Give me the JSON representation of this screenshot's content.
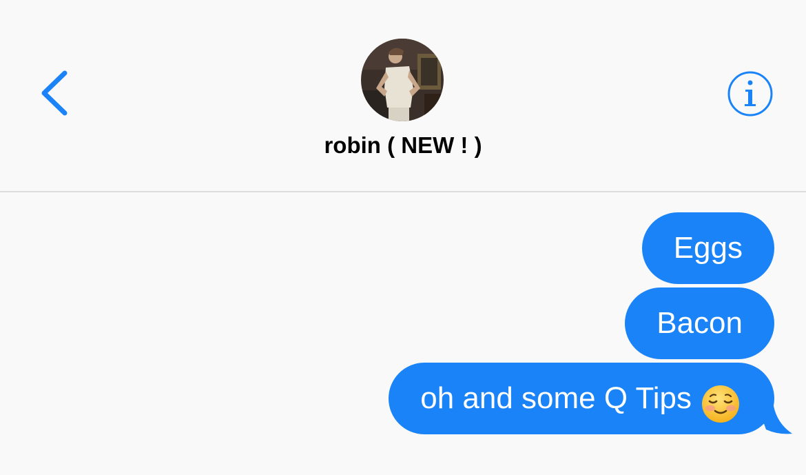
{
  "header": {
    "contact_name": "robin ( NEW ! )"
  },
  "icons": {
    "back": "chevron-left-icon",
    "info": "info-icon"
  },
  "colors": {
    "accent": "#1a83f8",
    "background": "#f9f9f9",
    "separator": "#dcdcdf",
    "bubble_text": "#ffffff"
  },
  "messages": [
    {
      "direction": "outgoing",
      "text": "Eggs"
    },
    {
      "direction": "outgoing",
      "text": "Bacon"
    },
    {
      "direction": "outgoing",
      "text": "oh and some Q Tips",
      "emoji": "smiling-face-icon"
    }
  ]
}
